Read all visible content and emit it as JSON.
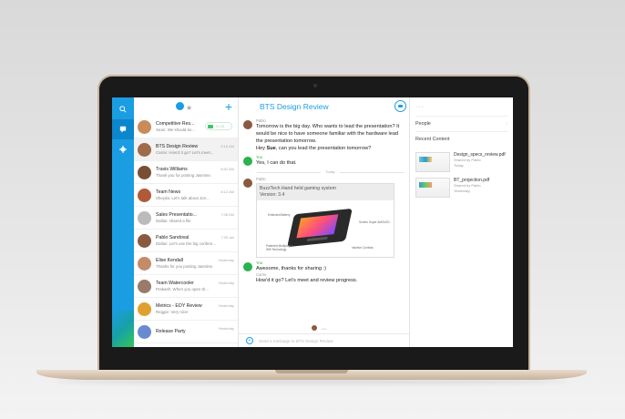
{
  "nav": {
    "icons": [
      "search-icon",
      "chat-icon",
      "gear-icon"
    ],
    "accent": "#1b9de2"
  },
  "list": {
    "header": {
      "plus": "+",
      "star": "★"
    },
    "rooms": [
      {
        "name": "Competitive Res...",
        "preview": "Sean: We should ke...",
        "time": "",
        "call_time": "01:15",
        "avatar_color": "#c98b5a"
      },
      {
        "name": "BTS Design Review",
        "preview": "Carrie: How'd it go? Let's meet...",
        "time": "9:16 AM",
        "avatar_color": "#a06b4a"
      },
      {
        "name": "Travis Williams",
        "preview": "Thank you for posting Jasmine.",
        "time": "8:52 AM",
        "avatar_color": "#7a4e35"
      },
      {
        "name": "Team News",
        "preview": "Sheyda: Let's talk about Jon...",
        "time": "8:12 AM",
        "avatar_color": "#b05a3a"
      },
      {
        "name": "Sales Presentatio...",
        "preview": "Dallas: shared a file",
        "time": "7:08 AM",
        "avatar_color": "#bbbbbb"
      },
      {
        "name": "Pablo Sandoval",
        "preview": "Dallas: Let's use the big confere...",
        "time": "7:05 am",
        "avatar_color": "#8a5a40"
      },
      {
        "name": "Elise Kendall",
        "preview": "Thanks for you posting Jasmine.",
        "time": "Yesterday",
        "avatar_color": "#c48a6a"
      },
      {
        "name": "Team Watercooler",
        "preview": "Prakash: When you open th...",
        "time": "Yesterday",
        "avatar_color": "#9a7a6a"
      },
      {
        "name": "Metrics - EOY Review",
        "preview": "Reggie: Very nice!",
        "time": "Yesterday",
        "avatar_color": "#e0a030"
      },
      {
        "name": "Release Party",
        "preview": "",
        "time": "Yesterday",
        "avatar_color": "#6a8ad0"
      }
    ]
  },
  "chat": {
    "title": "BTS Design Review",
    "messages": [
      {
        "sender": "Pablo",
        "text": "Tomorrow is the big day. Who wants to lead the presentation? It would be nice to have someone familiar with the hardware lead the presentation tomorrow."
      },
      {
        "sender": "",
        "text_pre": "Hey ",
        "text_bold": "Sue",
        "text_post": ", can you lead the presentation tomorrow?"
      },
      {
        "sender": "You",
        "text": "Yes, I can do that."
      },
      {
        "divider": "Today"
      },
      {
        "sender": "Pablo",
        "card_title": "BuzzTech Hand held gaming system",
        "card_version": "Version: 3.4"
      },
      {
        "sender": "You",
        "text": "Awesome, thanks for sharing :)"
      },
      {
        "sender": "Carrie",
        "text": "How'd it go? Let's meet and review progress."
      }
    ],
    "card_labels": [
      "Extended Battery",
      "Screen Super AMOLED",
      "Patented Multiplayer Wifi Technology",
      "Intuitive Controls"
    ],
    "typing": "...",
    "compose_placeholder": "Send a message to BTS Design Review"
  },
  "side": {
    "more": "···",
    "people_label": "People",
    "recent_label": "Recent Content",
    "files": [
      {
        "name": "Design_specs_review.pdf",
        "shared_by": "Shared by Pablo",
        "when": "Today"
      },
      {
        "name": "BT_projection.pdf",
        "shared_by": "Shared by Pablo",
        "when": "Yesterday"
      }
    ]
  }
}
